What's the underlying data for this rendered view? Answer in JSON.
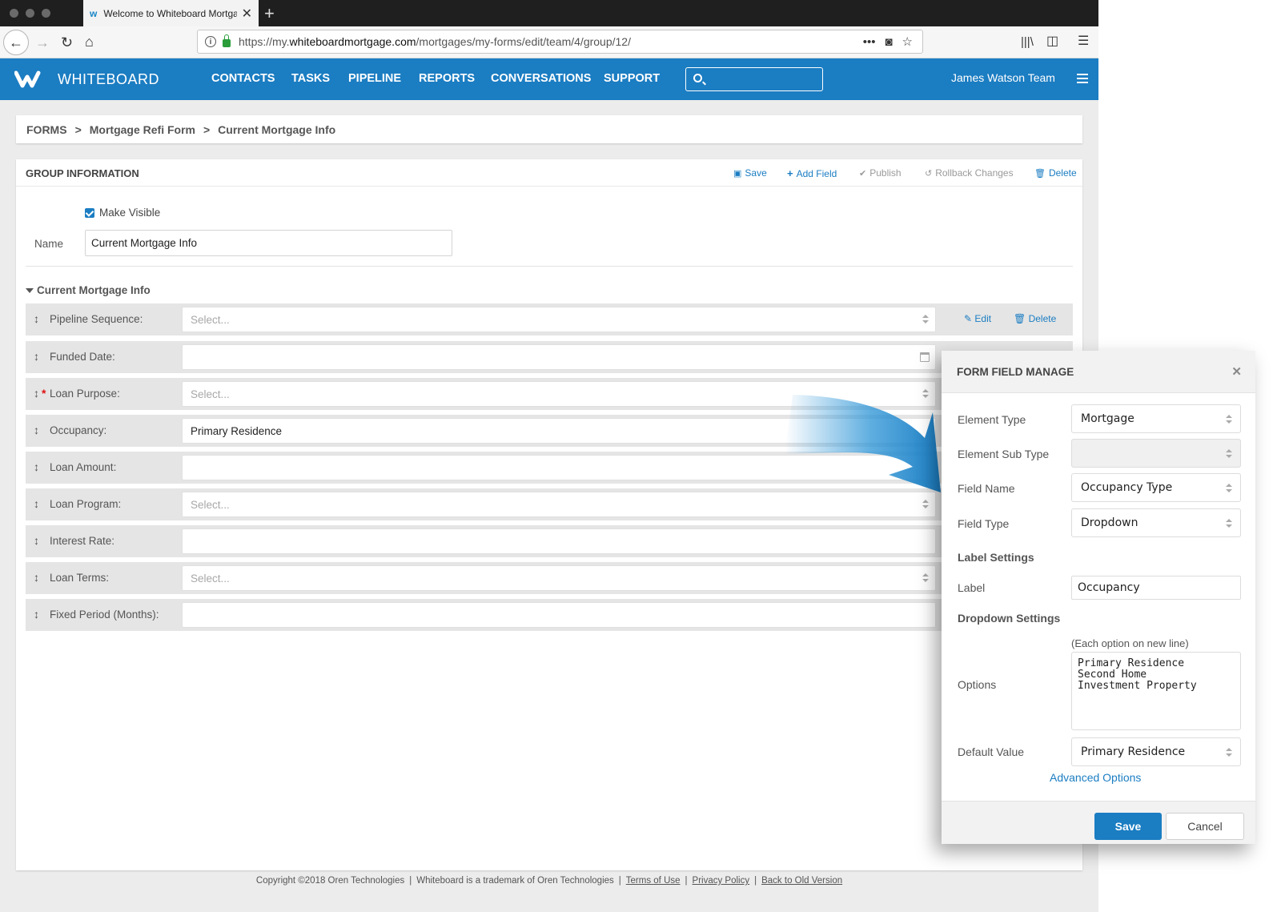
{
  "browser": {
    "tab_title": "Welcome to Whiteboard Mortga",
    "url_prefix": "https://my.",
    "url_domain": "whiteboardmortgage.com",
    "url_path": "/mortgages/my-forms/edit/team/4/group/12/"
  },
  "header": {
    "brand": "WHITEBOARD",
    "nav": [
      "CONTACTS",
      "TASKS",
      "PIPELINE",
      "REPORTS",
      "CONVERSATIONS",
      "SUPPORT"
    ],
    "search_placeholder": "",
    "team": "James Watson Team"
  },
  "breadcrumb": [
    "FORMS",
    "Mortgage Refi Form",
    "Current Mortgage Info"
  ],
  "breadcrumb_sep": ">",
  "group": {
    "title": "GROUP INFORMATION",
    "actions": {
      "save": "Save",
      "add_field": "Add Field",
      "publish": "Publish",
      "rollback": "Rollback Changes",
      "delete": "Delete"
    },
    "make_visible": "Make Visible",
    "name_label": "Name",
    "name_value": "Current Mortgage Info",
    "section_title": "Current Mortgage Info",
    "row_edit": "Edit",
    "row_delete": "Delete",
    "fields": [
      {
        "label": "Pipeline Sequence:",
        "value": "Select..."
      },
      {
        "label": "Funded Date:",
        "value": ""
      },
      {
        "label": "Loan Purpose:",
        "value": "Select..."
      },
      {
        "label": "Occupancy:",
        "value": "Primary Residence"
      },
      {
        "label": "Loan Amount:",
        "value": ""
      },
      {
        "label": "Loan Program:",
        "value": "Select..."
      },
      {
        "label": "Interest Rate:",
        "value": ""
      },
      {
        "label": "Loan Terms:",
        "value": "Select..."
      },
      {
        "label": "Fixed Period (Months):",
        "value": ""
      }
    ]
  },
  "modal": {
    "title": "FORM FIELD MANAGE",
    "element_type_label": "Element Type",
    "element_type_value": "Mortgage",
    "element_sub_type_label": "Element Sub Type",
    "element_sub_type_value": "",
    "field_name_label": "Field Name",
    "field_name_value": "Occupancy Type",
    "field_type_label": "Field Type",
    "field_type_value": "Dropdown",
    "label_settings": "Label Settings",
    "label_label": "Label",
    "label_value": "Occupancy",
    "dropdown_settings": "Dropdown Settings",
    "options_hint": "(Each option on new line)",
    "options_label": "Options",
    "options": [
      "Primary Residence",
      "Second Home",
      "Investment Property"
    ],
    "default_label": "Default Value",
    "default_value": "Primary Residence",
    "advanced": "Advanced Options",
    "save": "Save",
    "cancel": "Cancel"
  },
  "footer": {
    "copyright": "Copyright ©2018 Oren Technologies",
    "trademark": "Whiteboard is a trademark of Oren Technologies",
    "terms": "Terms of Use",
    "privacy": "Privacy Policy",
    "old_version": "Back to Old Version",
    "sep": "|"
  },
  "colors": {
    "brand": "#1b7dc2",
    "required": "#dd1111"
  }
}
